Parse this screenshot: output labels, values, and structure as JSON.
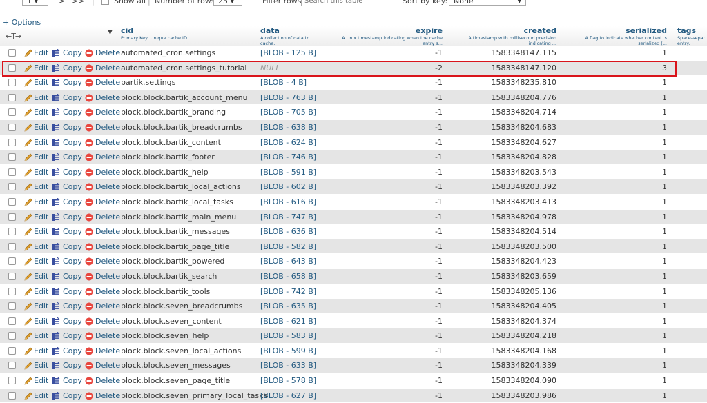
{
  "toolbar": {
    "page_select": "1",
    "next": ">",
    "last": ">>",
    "show_all": "Show all",
    "rows_label": "Number of rows:",
    "rows_value": "25",
    "filter_label": "Filter rows:",
    "filter_placeholder": "Search this table",
    "sort_label": "Sort by key:",
    "sort_value": "None"
  },
  "options_link": "+ Options",
  "header": {
    "arrows": "←T→",
    "cid": {
      "name": "cid",
      "desc": "Primary Key: Unique cache ID."
    },
    "data": {
      "name": "data",
      "desc1": "A collection of data to",
      "desc2": "cache."
    },
    "expire": {
      "name": "expire",
      "desc1": "A Unix timestamp indicating when the cache",
      "desc2": "entry s..."
    },
    "created": {
      "name": "created",
      "desc1": "A timestamp with millisecond precision",
      "desc2": "indicating ..."
    },
    "serialized": {
      "name": "serialized",
      "desc1": "A flag to indicate whether content is",
      "desc2": "serialized (..."
    },
    "tags": {
      "name": "tags",
      "desc1": "Space-separ",
      "desc2": "entry."
    }
  },
  "actions": {
    "edit": "Edit",
    "copy": "Copy",
    "delete": "Delete"
  },
  "colors": {
    "link": "#235a81",
    "highlight": "#d9141b",
    "delete": "#e8473f",
    "pencil": "#e0a030"
  },
  "rows": [
    {
      "cid": "automated_cron.settings",
      "data": "[BLOB - 125 B]",
      "expire": "-1",
      "created": "1583348147.115",
      "serialized": "1"
    },
    {
      "cid": "automated_cron.settings_tutorial",
      "data": "NULL",
      "expire": "-2",
      "created": "1583348147.120",
      "serialized": "3"
    },
    {
      "cid": "bartik.settings",
      "data": "[BLOB - 4 B]",
      "expire": "-1",
      "created": "1583348235.810",
      "serialized": "1"
    },
    {
      "cid": "block.block.bartik_account_menu",
      "data": "[BLOB - 763 B]",
      "expire": "-1",
      "created": "1583348204.776",
      "serialized": "1"
    },
    {
      "cid": "block.block.bartik_branding",
      "data": "[BLOB - 705 B]",
      "expire": "-1",
      "created": "1583348204.714",
      "serialized": "1"
    },
    {
      "cid": "block.block.bartik_breadcrumbs",
      "data": "[BLOB - 638 B]",
      "expire": "-1",
      "created": "1583348204.683",
      "serialized": "1"
    },
    {
      "cid": "block.block.bartik_content",
      "data": "[BLOB - 624 B]",
      "expire": "-1",
      "created": "1583348204.627",
      "serialized": "1"
    },
    {
      "cid": "block.block.bartik_footer",
      "data": "[BLOB - 746 B]",
      "expire": "-1",
      "created": "1583348204.828",
      "serialized": "1"
    },
    {
      "cid": "block.block.bartik_help",
      "data": "[BLOB - 591 B]",
      "expire": "-1",
      "created": "1583348203.543",
      "serialized": "1"
    },
    {
      "cid": "block.block.bartik_local_actions",
      "data": "[BLOB - 602 B]",
      "expire": "-1",
      "created": "1583348203.392",
      "serialized": "1"
    },
    {
      "cid": "block.block.bartik_local_tasks",
      "data": "[BLOB - 616 B]",
      "expire": "-1",
      "created": "1583348203.413",
      "serialized": "1"
    },
    {
      "cid": "block.block.bartik_main_menu",
      "data": "[BLOB - 747 B]",
      "expire": "-1",
      "created": "1583348204.978",
      "serialized": "1"
    },
    {
      "cid": "block.block.bartik_messages",
      "data": "[BLOB - 636 B]",
      "expire": "-1",
      "created": "1583348204.514",
      "serialized": "1"
    },
    {
      "cid": "block.block.bartik_page_title",
      "data": "[BLOB - 582 B]",
      "expire": "-1",
      "created": "1583348203.500",
      "serialized": "1"
    },
    {
      "cid": "block.block.bartik_powered",
      "data": "[BLOB - 643 B]",
      "expire": "-1",
      "created": "1583348204.423",
      "serialized": "1"
    },
    {
      "cid": "block.block.bartik_search",
      "data": "[BLOB - 658 B]",
      "expire": "-1",
      "created": "1583348203.659",
      "serialized": "1"
    },
    {
      "cid": "block.block.bartik_tools",
      "data": "[BLOB - 742 B]",
      "expire": "-1",
      "created": "1583348205.136",
      "serialized": "1"
    },
    {
      "cid": "block.block.seven_breadcrumbs",
      "data": "[BLOB - 635 B]",
      "expire": "-1",
      "created": "1583348204.405",
      "serialized": "1"
    },
    {
      "cid": "block.block.seven_content",
      "data": "[BLOB - 621 B]",
      "expire": "-1",
      "created": "1583348204.374",
      "serialized": "1"
    },
    {
      "cid": "block.block.seven_help",
      "data": "[BLOB - 583 B]",
      "expire": "-1",
      "created": "1583348204.218",
      "serialized": "1"
    },
    {
      "cid": "block.block.seven_local_actions",
      "data": "[BLOB - 599 B]",
      "expire": "-1",
      "created": "1583348204.168",
      "serialized": "1"
    },
    {
      "cid": "block.block.seven_messages",
      "data": "[BLOB - 633 B]",
      "expire": "-1",
      "created": "1583348204.339",
      "serialized": "1"
    },
    {
      "cid": "block.block.seven_page_title",
      "data": "[BLOB - 578 B]",
      "expire": "-1",
      "created": "1583348204.090",
      "serialized": "1"
    },
    {
      "cid": "block.block.seven_primary_local_tasks",
      "data": "[BLOB - 627 B]",
      "expire": "-1",
      "created": "1583348203.986",
      "serialized": "1"
    }
  ]
}
